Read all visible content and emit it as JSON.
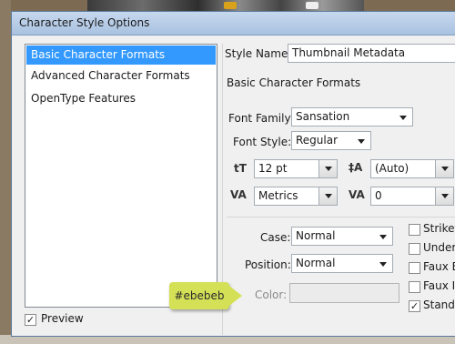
{
  "window": {
    "title": "Character Style Options"
  },
  "categories": [
    {
      "label": "Basic Character Formats",
      "selected": true
    },
    {
      "label": "Advanced Character Formats",
      "selected": false
    },
    {
      "label": "OpenType Features",
      "selected": false
    }
  ],
  "preview": {
    "label": "Preview",
    "checked": true,
    "mark": "✓"
  },
  "style_name": {
    "label": "Style Name:",
    "value": "Thumbnail Metadata"
  },
  "section_title": "Basic Character Formats",
  "font_family": {
    "label": "Font Family:",
    "value": "Sansation"
  },
  "font_style": {
    "label": "Font Style:",
    "value": "Regular"
  },
  "font_size": {
    "icon": "font-size-icon",
    "value": "12 pt"
  },
  "leading": {
    "icon": "leading-icon",
    "value": "(Auto)"
  },
  "kerning": {
    "icon": "kerning-icon",
    "value": "Metrics"
  },
  "tracking": {
    "icon": "tracking-icon",
    "value": "0"
  },
  "case": {
    "label": "Case:",
    "value": "Normal"
  },
  "position": {
    "label": "Position:",
    "value": "Normal"
  },
  "color": {
    "label": "Color:",
    "swatch": "#ebebeb"
  },
  "checkboxes": [
    {
      "label": "Striket",
      "checked": false,
      "mark": ""
    },
    {
      "label": "Underl",
      "checked": false,
      "mark": ""
    },
    {
      "label": "Faux B",
      "checked": false,
      "mark": ""
    },
    {
      "label": "Faux It",
      "checked": false,
      "mark": ""
    },
    {
      "label": "Standa",
      "checked": true,
      "mark": "✓"
    }
  ],
  "annotation": {
    "text": "#ebebeb",
    "color": "#d4e157"
  }
}
